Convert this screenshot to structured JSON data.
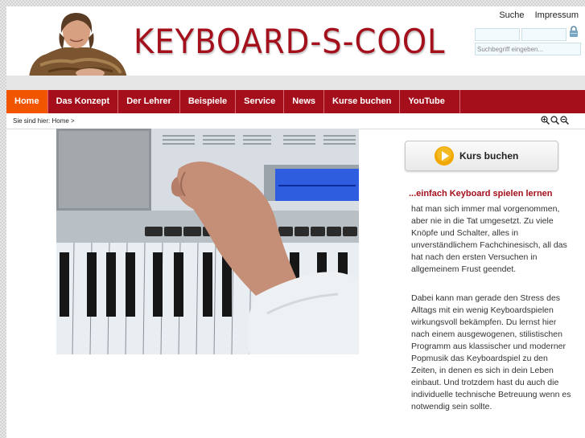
{
  "header": {
    "logo_text": "KEYBOARD-S-COOL",
    "top_links": [
      "Suche",
      "Impressum"
    ],
    "search_placeholder": "Suchbegriff eingeben..."
  },
  "nav": {
    "items": [
      {
        "label": "Home",
        "active": true
      },
      {
        "label": "Das Konzept"
      },
      {
        "label": "Der Lehrer"
      },
      {
        "label": "Beispiele"
      },
      {
        "label": "Service"
      },
      {
        "label": "News"
      },
      {
        "label": "Kurse buchen"
      },
      {
        "label": "YouTube"
      }
    ]
  },
  "breadcrumb": {
    "text": "Sie sind hier: Home >"
  },
  "zoom_icons": [
    "zoom-in-icon",
    "zoom-reset-icon",
    "zoom-out-icon"
  ],
  "sidebar": {
    "cta_label": "Kurs buchen",
    "tagline": "...einfach Keyboard spielen lernen",
    "paragraphs": [
      "hat man sich immer mal vorgenommen, aber nie in die Tat umgesetzt. Zu viele Knöpfe und Schalter, alles in unverständlichem Fachchinesisch, all das hat nach den ersten Versuchen in allgemeinem Frust geendet.",
      "Dabei kann man gerade den Stress des Alltags mit ein wenig Keyboardspielen wirkungsvoll bekämpfen. Du lernst hier nach einem ausgewogenen, stilistischen Programm aus klassischer und moderner Popmusik das Keyboardspiel zu den Zeiten, in denen es sich in dein Leben einbaut. Und trotzdem hast du auch die individuelle technische Betreuung wenn es notwendig sein sollte."
    ]
  },
  "colors": {
    "brand_red": "#a50f1c",
    "active_orange": "#f25500"
  }
}
